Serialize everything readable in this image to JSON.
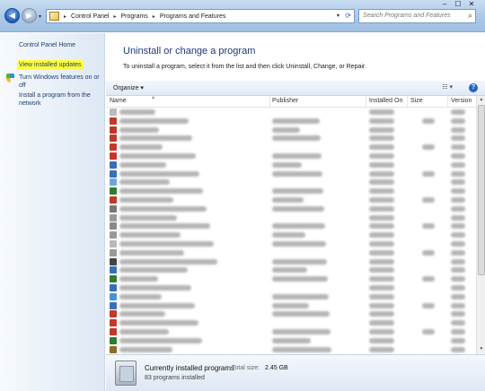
{
  "address": {
    "crumbs": [
      "Control Panel",
      "Programs",
      "Programs and Features"
    ]
  },
  "search": {
    "placeholder": "Search Programs and Features"
  },
  "left_pane": {
    "home": "Control Panel Home",
    "view_updates": "View installed updates",
    "features": "Turn Windows features on or off",
    "install": "Install a program from the network"
  },
  "header": {
    "title": "Uninstall or change a program",
    "subtitle": "To uninstall a program, select it from the list and then click Uninstall, Change, or Repair."
  },
  "toolbar": {
    "organize": "Organize ▾"
  },
  "columns": {
    "name": "Name",
    "publisher": "Publisher",
    "installed_on": "Installed On",
    "size": "Size",
    "version": "Version"
  },
  "details": {
    "heading": "Currently installed programs",
    "total_label": "Total size:",
    "total_size": "2.45 GB",
    "count": "83 programs installed"
  },
  "colors": {
    "highlight": "#ffff3a",
    "link": "#1d3d72",
    "title": "#1d3a78"
  }
}
